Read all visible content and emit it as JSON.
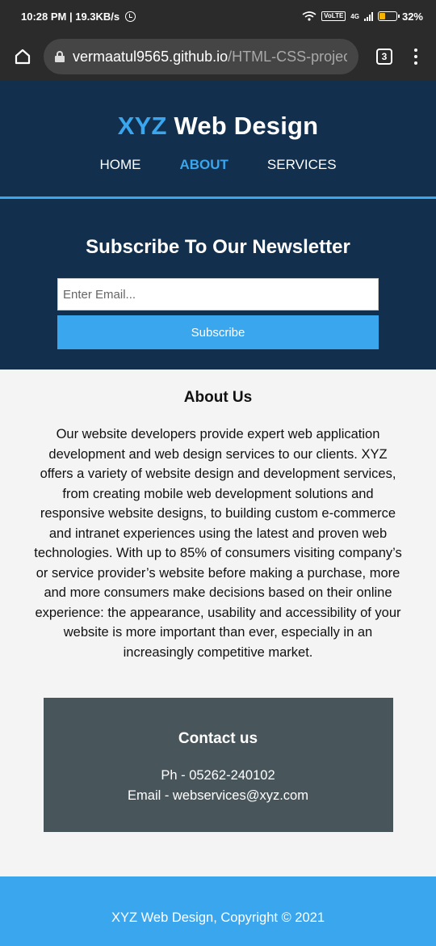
{
  "status_bar": {
    "time_speed": "10:28 PM | 19.3KB/s",
    "volte": "VoLTE",
    "network": "4G",
    "battery": "32%",
    "battery_level": 0.32
  },
  "browser": {
    "url_host": "vermaatul9565.github.io",
    "url_path": "/HTML-CSS-projec",
    "tab_count": "3"
  },
  "header": {
    "logo_accent": "XYZ",
    "logo_rest": "Web Design",
    "nav": [
      "HOME",
      "ABOUT",
      "SERVICES"
    ],
    "active_nav": "ABOUT"
  },
  "newsletter": {
    "title": "Subscribe To Our Newsletter",
    "email_placeholder": "Enter Email...",
    "button_label": "Subscribe"
  },
  "about": {
    "title": "About Us",
    "body": "Our website developers provide expert web application development and web design services to our clients. XYZ offers a variety of website design and development services, from creating mobile web development solutions and responsive website designs, to building custom e-commerce and intranet experiences using the latest and proven web technologies. With up to 85% of consumers visiting company’s or service provider’s website before making a purchase, more and more consumers make decisions based on their online experience: the appearance, usability and accessibility of your website is more important than ever, especially in an increasingly competitive market."
  },
  "contact": {
    "title": "Contact us",
    "phone": "Ph - 05262-240102",
    "email": "Email - webservices@xyz.com"
  },
  "footer": {
    "text": "XYZ Web Design, Copyright © 2021"
  },
  "colors": {
    "navy": "#12304d",
    "accent": "#3aa6ee",
    "contact_bg": "#48555b",
    "page_bg": "#f4f4f4"
  }
}
